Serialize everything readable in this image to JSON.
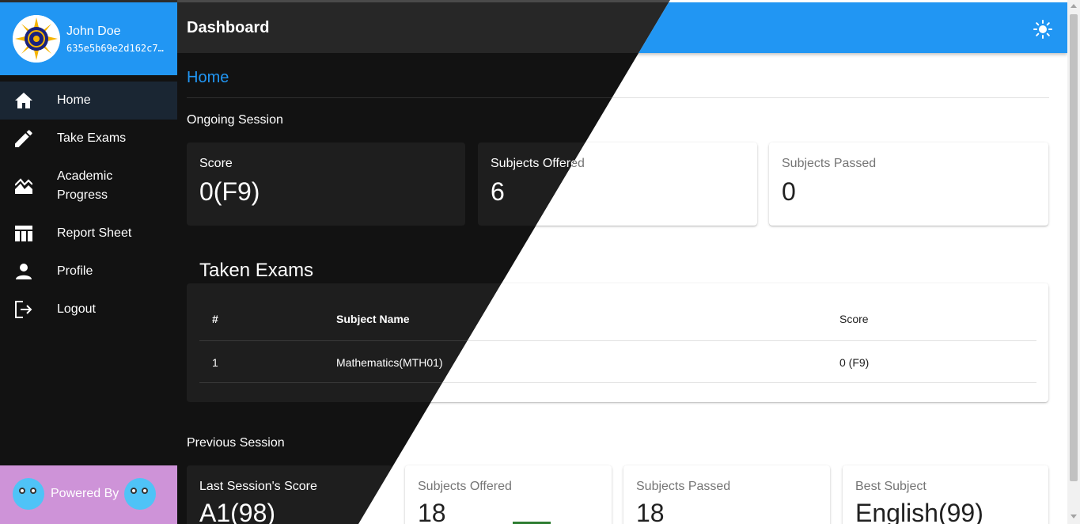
{
  "user": {
    "name": "John Doe",
    "id": "635e5b69e2d162c7"
  },
  "header": {
    "title": "Dashboard",
    "theme_icon": "sun-icon"
  },
  "sidebar": {
    "items": [
      {
        "label": "Home",
        "icon": "home-icon",
        "active": true
      },
      {
        "label": "Take Exams",
        "icon": "pencil-icon"
      },
      {
        "label": "Academic Progress",
        "icon": "chart-icon"
      },
      {
        "label": "Report Sheet",
        "icon": "table-icon"
      },
      {
        "label": "Profile",
        "icon": "person-icon"
      },
      {
        "label": "Logout",
        "icon": "logout-icon"
      }
    ],
    "powered_by": "Powered By"
  },
  "breadcrumb": "Home",
  "ongoing": {
    "label": "Ongoing Session",
    "cards": [
      {
        "title": "Score",
        "value": "0(F9)"
      },
      {
        "title": "Subjects Offered",
        "value": "6"
      },
      {
        "title": "Subjects Passed",
        "value": "0"
      }
    ]
  },
  "exams_table": {
    "heading": "Taken Exams",
    "columns": [
      "#",
      "Subject Name",
      "Score"
    ],
    "rows": [
      [
        "1",
        "Mathematics(MTH01)",
        "0 (F9)"
      ]
    ]
  },
  "previous": {
    "label": "Previous Session",
    "cards": [
      {
        "title": "Last Session's Score",
        "value": "A1(98)"
      },
      {
        "title": "Subjects Offered",
        "value": "18"
      },
      {
        "title": "Subjects Passed",
        "value": "18"
      },
      {
        "title": "Best Subject",
        "value": "English(99)"
      }
    ]
  },
  "colors": {
    "accent": "#2196f3",
    "sidebar_bg": "#121212",
    "powered_bg": "#ce93d8"
  }
}
